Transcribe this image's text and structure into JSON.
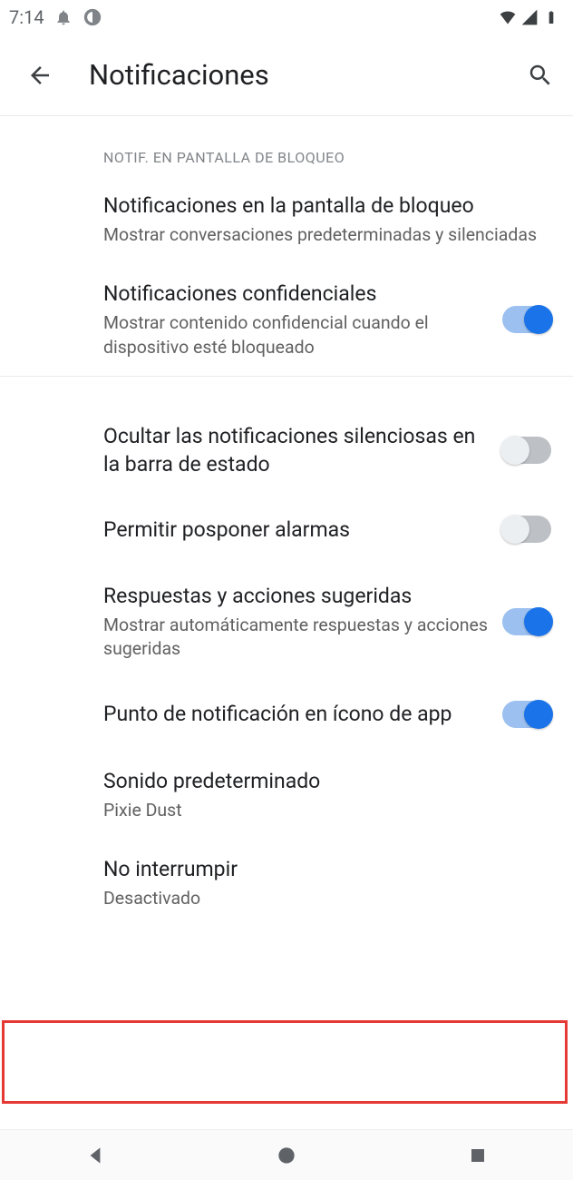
{
  "statusbar": {
    "time": "7:14"
  },
  "appbar": {
    "title": "Notificaciones"
  },
  "section": {
    "lock_header": "NOTIF. EN PANTALLA DE BLOQUEO"
  },
  "items": {
    "lock_notifications": {
      "title": "Notificaciones en la pantalla de bloqueo",
      "sub": "Mostrar conversaciones predeterminadas y silenciadas"
    },
    "sensitive": {
      "title": "Notificaciones confidenciales",
      "sub": "Mostrar contenido confidencial cuando el dispositivo esté bloqueado"
    },
    "hide_silent": {
      "title": "Ocultar las notificaciones silenciosas en la barra de estado"
    },
    "snooze": {
      "title": "Permitir posponer alarmas"
    },
    "suggested": {
      "title": "Respuestas y acciones sugeridas",
      "sub": "Mostrar automáticamente respuestas y acciones sugeridas"
    },
    "dot": {
      "title": "Punto de notificación en ícono de app"
    },
    "sound": {
      "title": "Sonido predeterminado",
      "sub": "Pixie Dust"
    },
    "dnd": {
      "title": "No interrumpir",
      "sub": "Desactivado"
    }
  }
}
